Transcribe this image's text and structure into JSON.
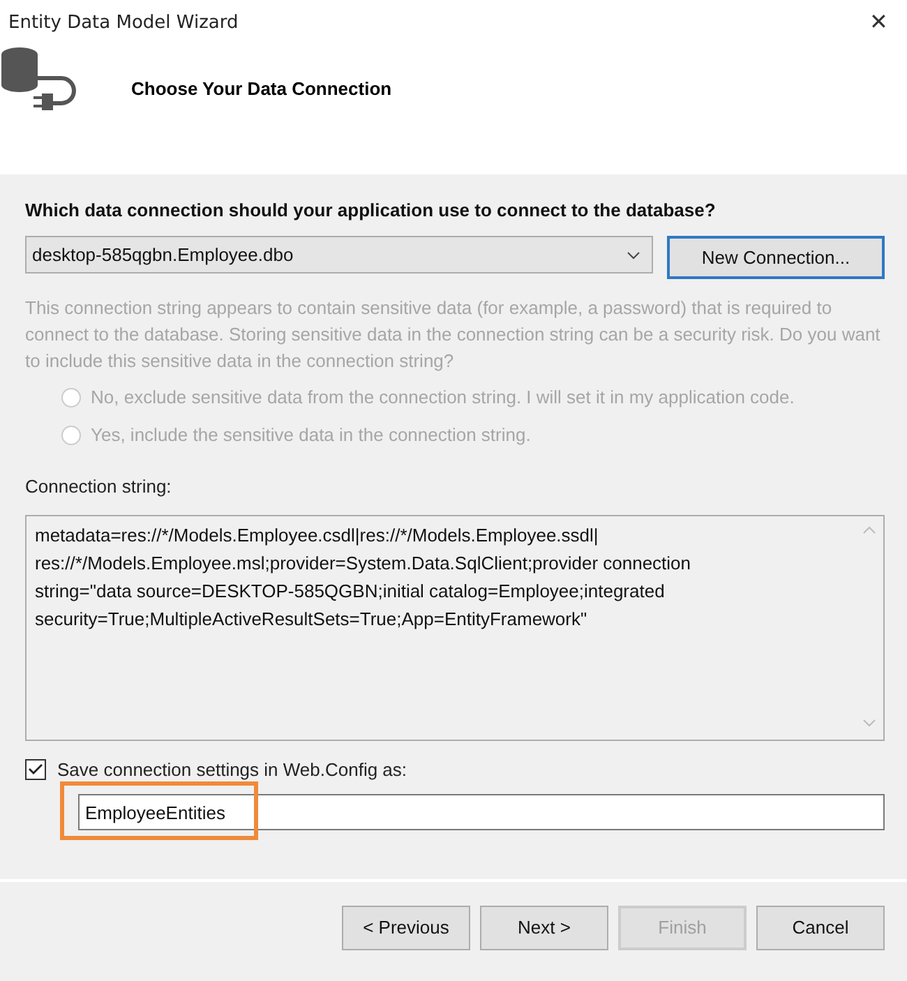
{
  "window": {
    "title": "Entity Data Model Wizard",
    "close": "✕"
  },
  "header": {
    "title": "Choose Your Data Connection"
  },
  "question": "Which data connection should your application use to connect to the database?",
  "connection_select": {
    "value": "desktop-585qgbn.Employee.dbo"
  },
  "new_connection_button": {
    "label": "New Connection...",
    "focused": true
  },
  "sensitive": {
    "disabled": true,
    "text": "This connection string appears to contain sensitive data (for example, a password) that is required to connect to the database. Storing sensitive data in the connection string can be a security risk. Do you want to include this sensitive data in the connection string?",
    "options": [
      {
        "label": "No, exclude sensitive data from the connection string. I will set it in my application code.",
        "selected": false
      },
      {
        "label": "Yes, include the sensitive data in the connection string.",
        "selected": false
      }
    ]
  },
  "connection_string": {
    "label": "Connection string:",
    "value": "metadata=res://*/Models.Employee.csdl|res://*/Models.Employee.ssdl|\nres://*/Models.Employee.msl;provider=System.Data.SqlClient;provider connection\nstring=\"data source=DESKTOP-585QGBN;initial catalog=Employee;integrated\nsecurity=True;MultipleActiveResultSets=True;App=EntityFramework\""
  },
  "save_settings": {
    "label": "Save connection settings in Web.Config as:",
    "checked": true,
    "value": "EmployeeEntities",
    "highlighted": true
  },
  "buttons": [
    {
      "label": "< Previous",
      "disabled": false,
      "focused": false
    },
    {
      "label": "Next >",
      "disabled": false,
      "focused": false
    },
    {
      "label": "Finish",
      "disabled": true,
      "focused": false
    },
    {
      "label": "Cancel",
      "disabled": false,
      "focused": false
    }
  ]
}
